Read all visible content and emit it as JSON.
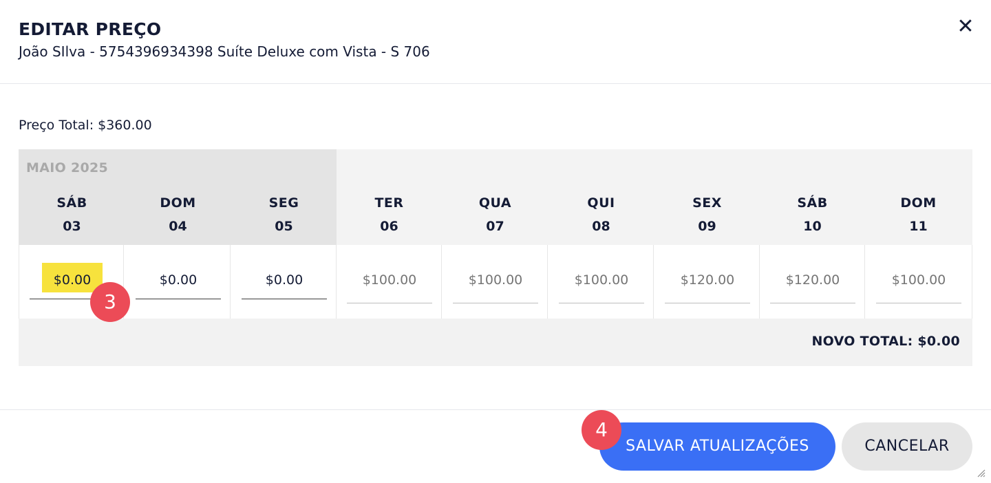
{
  "dialog": {
    "title": "EDITAR PREÇO",
    "subtitle": "João SIlva - 5754396934398 Suíte Deluxe com Vista - S 706",
    "close_icon": "close-icon"
  },
  "price_total": "Preço Total: $360.00",
  "calendar": {
    "month": "MAIO 2025",
    "days": [
      {
        "name": "SÁB",
        "date": "03",
        "value": "$0.00",
        "placeholder": ""
      },
      {
        "name": "DOM",
        "date": "04",
        "value": "$0.00",
        "placeholder": ""
      },
      {
        "name": "SEG",
        "date": "05",
        "value": "$0.00",
        "placeholder": ""
      },
      {
        "name": "TER",
        "date": "06",
        "value": "",
        "placeholder": "$100.00"
      },
      {
        "name": "QUA",
        "date": "07",
        "value": "",
        "placeholder": "$100.00"
      },
      {
        "name": "QUI",
        "date": "08",
        "value": "",
        "placeholder": "$100.00"
      },
      {
        "name": "SEX",
        "date": "09",
        "value": "",
        "placeholder": "$120.00"
      },
      {
        "name": "SÁB",
        "date": "10",
        "value": "",
        "placeholder": "$120.00"
      },
      {
        "name": "DOM",
        "date": "11",
        "value": "",
        "placeholder": "$100.00"
      }
    ]
  },
  "new_total": "NOVO TOTAL: $0.00",
  "actions": {
    "save_label": "SALVAR ATUALIZAÇÕES",
    "cancel_label": "CANCELAR"
  },
  "annotations": {
    "step3": "3",
    "step4": "4"
  },
  "colors": {
    "primary": "#3a6ff5",
    "highlight": "#f7e23d",
    "badge": "#ec4b57"
  }
}
